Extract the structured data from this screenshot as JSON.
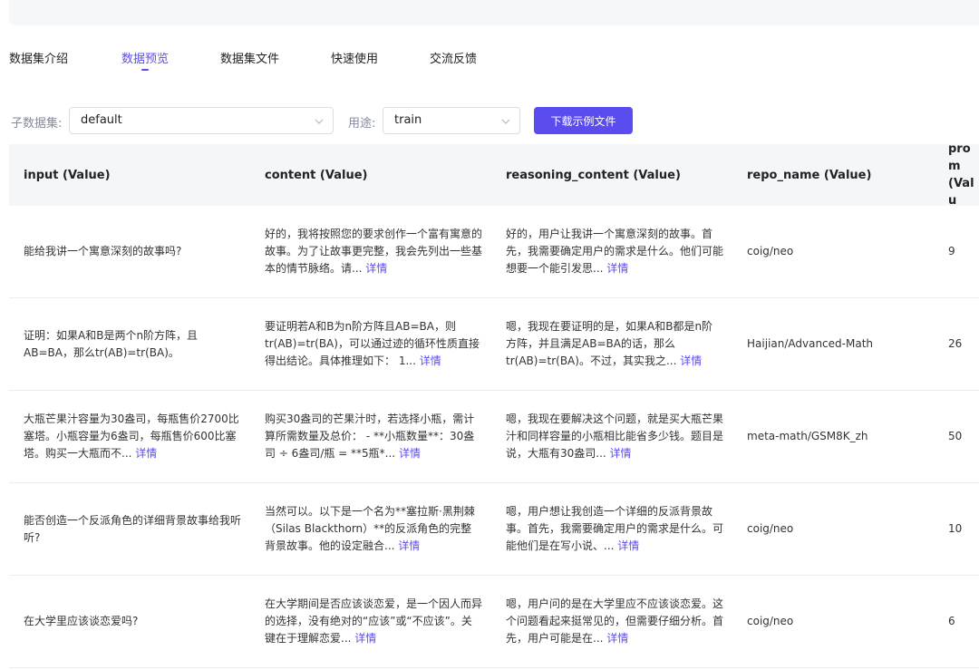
{
  "tabs": [
    {
      "label": "数据集介绍",
      "active": false
    },
    {
      "label": "数据预览",
      "active": true
    },
    {
      "label": "数据集文件",
      "active": false
    },
    {
      "label": "快速使用",
      "active": false
    },
    {
      "label": "交流反馈",
      "active": false
    }
  ],
  "filters": {
    "subset_label": "子数据集:",
    "subset_value": "default",
    "usage_label": "用途:",
    "usage_value": "train",
    "download_label": "下载示例文件"
  },
  "table": {
    "headers": [
      "input (Value)",
      "content (Value)",
      "reasoning_content (Value)",
      "repo_name (Value)",
      "prom (Valu"
    ],
    "detail_label": "详情",
    "rows": [
      {
        "input": "能给我讲一个寓意深刻的故事吗?",
        "input_more": false,
        "content": "好的，我将按照您的要求创作一个富有寓意的故事。为了让故事更完整，我会先列出一些基本的情节脉络。请...",
        "reasoning": "好的，用户让我讲一个寓意深刻的故事。首先，我需要确定用户的需求是什么。他们可能想要一个能引发思...",
        "repo": "coig/neo",
        "prompt": "9"
      },
      {
        "input": "证明：如果A和B是两个n阶方阵，且AB=BA，那么tr(AB)=tr(BA)。",
        "input_more": false,
        "content": "要证明若A和B为n阶方阵且AB=BA，则tr(AB)=tr(BA)，可以通过迹的循环性质直接得出结论。具体推理如下： 1...",
        "reasoning": "嗯，我现在要证明的是，如果A和B都是n阶方阵，并且满足AB=BA的话，那么tr(AB)=tr(BA)。不过，其实我之...",
        "repo": "Haijian/Advanced-Math",
        "prompt": "26"
      },
      {
        "input": "大瓶芒果汁容量为30盎司，每瓶售价2700比塞塔。小瓶容量为6盎司，每瓶售价600比塞塔。购买一大瓶而不...",
        "input_more": true,
        "content": "购买30盎司的芒果汁时，若选择小瓶，需计算所需数量及总价： - **小瓶数量**：30盎司 ÷ 6盎司/瓶 = **5瓶*...",
        "reasoning": "嗯，我现在要解决这个问题，就是买大瓶芒果汁和同样容量的小瓶相比能省多少钱。题目是说，大瓶有30盎司...",
        "repo": "meta-math/GSM8K_zh",
        "prompt": "50"
      },
      {
        "input": "能否创造一个反派角色的详细背景故事给我听听?",
        "input_more": false,
        "content": "当然可以。以下是一个名为**塞拉斯·黑荆棘（Silas Blackthorn）**的反派角色的完整背景故事。他的设定融合...",
        "reasoning": "嗯，用户想让我创造一个详细的反派背景故事。首先，我需要确定用户的需求是什么。可能他们是在写小说、...",
        "repo": "coig/neo",
        "prompt": "10"
      },
      {
        "input": "在大学里应该谈恋爱吗?",
        "input_more": false,
        "content": "在大学期间是否应该谈恋爱，是一个因人而异的选择，没有绝对的“应该”或“不应该”。关键在于理解恋爱...",
        "reasoning": "嗯，用户问的是在大学里应不应该谈恋爱。这个问题看起来挺常见的，但需要仔细分析。首先，用户可能是在...",
        "repo": "coig/neo",
        "prompt": "6"
      }
    ]
  }
}
